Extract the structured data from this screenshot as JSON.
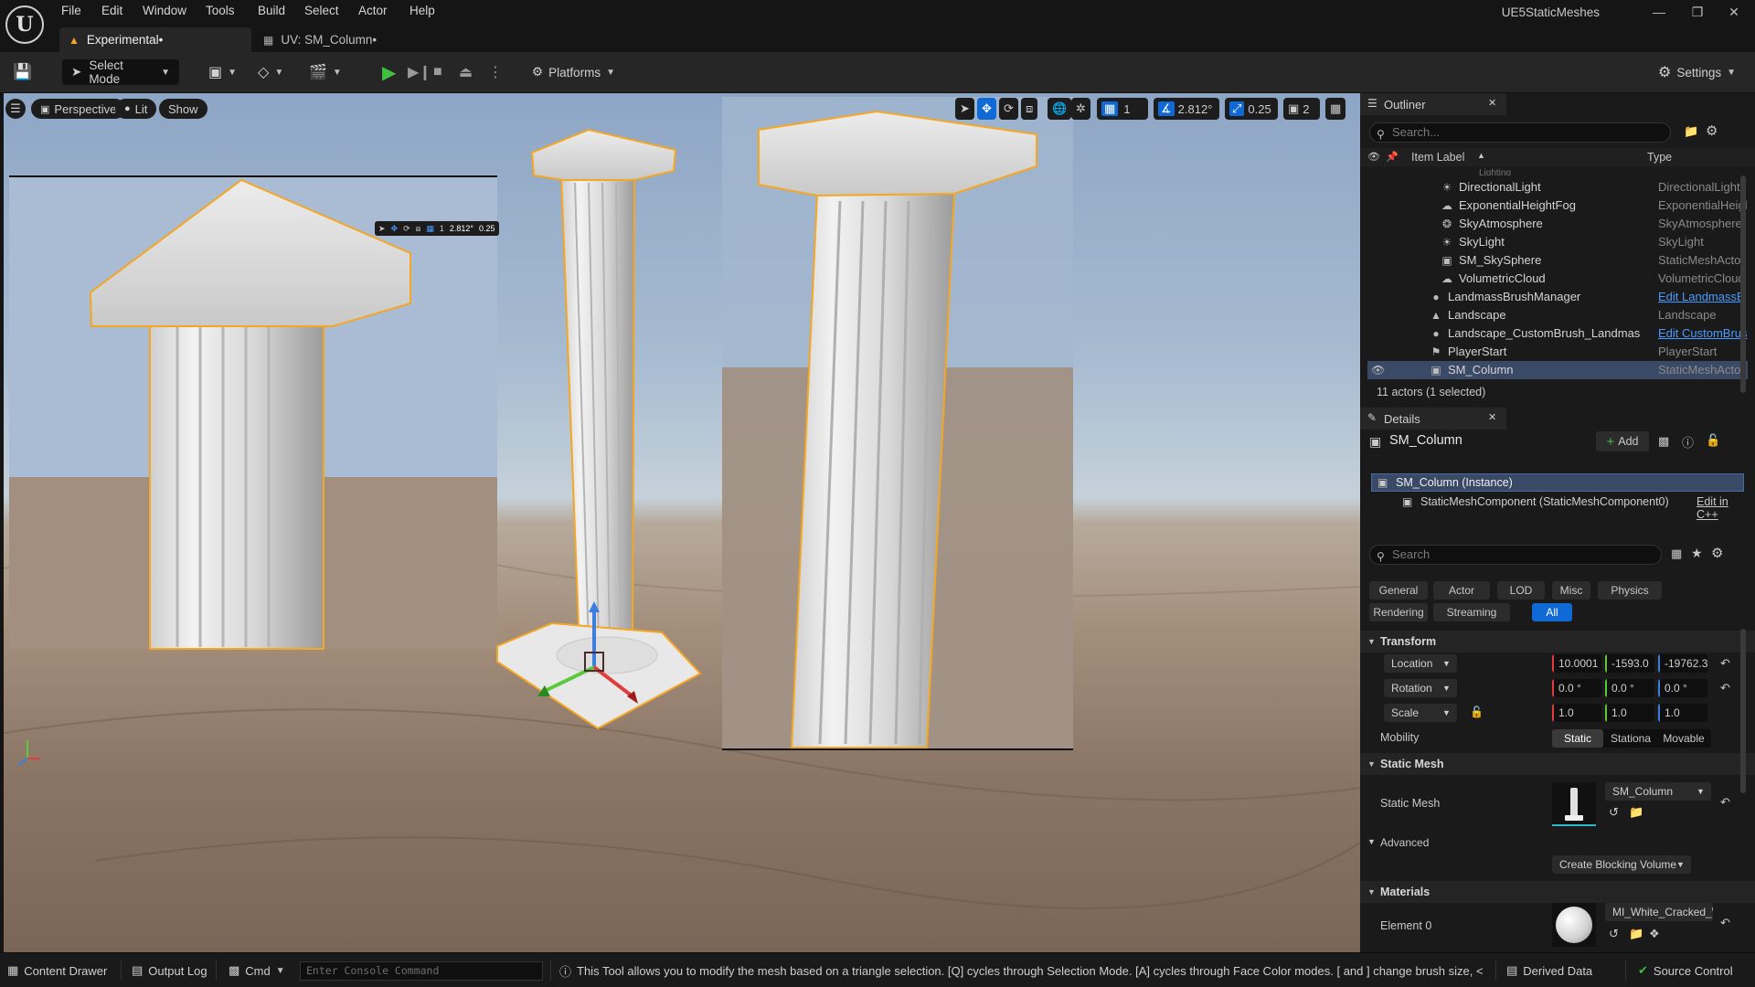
{
  "menu": [
    "File",
    "Edit",
    "Window",
    "Tools",
    "Build",
    "Select",
    "Actor",
    "Help"
  ],
  "project_name": "UE5StaticMeshes",
  "tabs": {
    "main": "Experimental•",
    "uv": "UV: SM_Column•"
  },
  "toolbar": {
    "select_mode": "Select Mode",
    "platforms": "Platforms",
    "settings": "Settings"
  },
  "viewport": {
    "perspective": "Perspective",
    "lit": "Lit",
    "show": "Show",
    "grid_snap": "1",
    "rotation_snap": "2.812°",
    "scale_snap": "0.25",
    "camera_speed": "2",
    "inset_rotation_snap": "2.812°",
    "inset_scale_snap": "0.25",
    "inset_grid": "1"
  },
  "outliner": {
    "title": "Outliner",
    "search_placeholder": "Search...",
    "col_label": "Item Label",
    "col_type": "Type",
    "partial_top": "Lighting",
    "rows": [
      {
        "label": "DirectionalLight",
        "type": "DirectionalLight",
        "icon": "light-icon"
      },
      {
        "label": "ExponentialHeightFog",
        "type": "ExponentialHeigl",
        "icon": "fog-icon"
      },
      {
        "label": "SkyAtmosphere",
        "type": "SkyAtmosphere",
        "icon": "sky-icon"
      },
      {
        "label": "SkyLight",
        "type": "SkyLight",
        "icon": "skylight-icon"
      },
      {
        "label": "SM_SkySphere",
        "type": "StaticMeshActor",
        "icon": "mesh-icon"
      },
      {
        "label": "VolumetricCloud",
        "type": "VolumetricCloud",
        "icon": "cloud-icon"
      },
      {
        "label": "LandmassBrushManager",
        "type": "Edit LandmassB",
        "icon": "actor-icon",
        "link": true
      },
      {
        "label": "Landscape",
        "type": "Landscape",
        "icon": "landscape-icon"
      },
      {
        "label": "Landscape_CustomBrush_Landmas",
        "type": "Edit CustomBrus",
        "icon": "actor-icon",
        "link": true
      },
      {
        "label": "PlayerStart",
        "type": "PlayerStart",
        "icon": "playerstart-icon"
      },
      {
        "label": "SM_Column",
        "type": "StaticMeshActor",
        "icon": "mesh-icon",
        "selected": true
      }
    ],
    "footer": "11 actors (1 selected)"
  },
  "details": {
    "title": "Details",
    "actor_name": "SM_Column",
    "add_label": "Add",
    "instance": "SM_Column (Instance)",
    "component": "StaticMeshComponent (StaticMeshComponent0)",
    "edit_cpp": "Edit in C++",
    "search_placeholder": "Search",
    "categories_row1": [
      "General",
      "Actor",
      "LOD",
      "Misc",
      "Physics"
    ],
    "categories_row2": [
      "Rendering",
      "Streaming",
      "All"
    ],
    "transform": {
      "section": "Transform",
      "location_label": "Location",
      "location": [
        "10.0001",
        "-1593.0",
        "-19762.3"
      ],
      "rotation_label": "Rotation",
      "rotation": [
        "0.0 °",
        "0.0 °",
        "0.0 °"
      ],
      "scale_label": "Scale",
      "scale": [
        "1.0",
        "1.0",
        "1.0"
      ],
      "mobility_label": "Mobility",
      "mobility_options": [
        "Static",
        "Stationa",
        "Movable"
      ]
    },
    "static_mesh": {
      "section": "Static Mesh",
      "label": "Static Mesh",
      "value": "SM_Column",
      "advanced": "Advanced",
      "blocking_volume": "Create Blocking Volume"
    },
    "materials": {
      "section": "Materials",
      "element_label": "Element 0",
      "value": "MI_White_Cracked_Wa"
    }
  },
  "statusbar": {
    "content_drawer": "Content Drawer",
    "output_log": "Output Log",
    "cmd": "Cmd",
    "console_placeholder": "Enter Console Command",
    "hint": "This Tool allows you to modify the mesh based on a triangle selection. [Q] cycles through Selection Mode. [A] cycles through Face Color modes. [ and ] change brush size, < and",
    "derived_data": "Derived Data",
    "source_control": "Source Control"
  },
  "colors": {
    "accent_blue": "#0f6ad6",
    "play_green": "#3fbf3f",
    "selection_orange": "#f5a623",
    "axis_x": "#e03c3c",
    "axis_y": "#5cc93c",
    "axis_z": "#3c7de0"
  }
}
